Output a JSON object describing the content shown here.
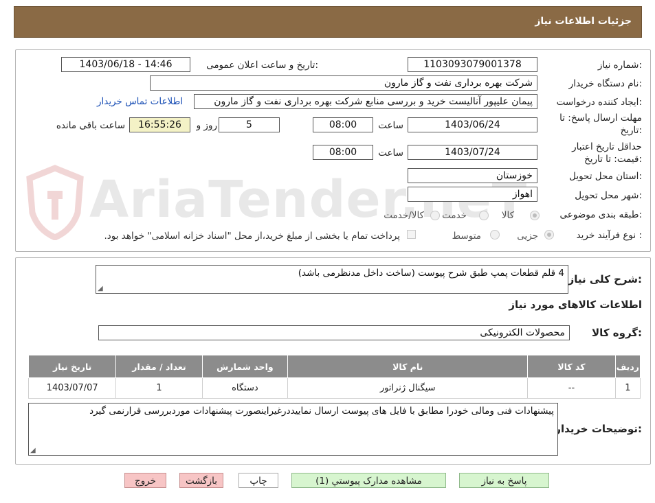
{
  "header": {
    "title": "جزئیات اطلاعات نیاز"
  },
  "form": {
    "need_number_label": "شماره نیاز:",
    "need_number": "1103093079001378",
    "announce_label": "تاریخ و ساعت اعلان عمومی:",
    "announce_value": "1403/06/18 - 14:46",
    "buyer_org_label": "نام دستگاه خریدار:",
    "buyer_org": "شرکت بهره برداری نفت و گاز مارون",
    "creator_label": "ایجاد کننده درخواست:",
    "creator": "پیمان علیپور آنالیست خرید و بررسی منابع شرکت بهره برداری نفت و گاز مارون",
    "contact_link": "اطلاعات تماس خریدار",
    "reply_deadline_label_1": "مهلت ارسال پاسخ: تا",
    "reply_deadline_label_2": "تاریخ:",
    "reply_date": "1403/06/24",
    "time_label": "ساعت",
    "reply_time": "08:00",
    "days_value": "5",
    "days_label": "روز و",
    "remaining_time": "16:55:26",
    "remaining_label": "ساعت باقی مانده",
    "validity_label_1": "حداقل تاریخ اعتبار",
    "validity_label_2": "قیمت: تا تاریخ:",
    "validity_date": "1403/07/24",
    "validity_time": "08:00",
    "province_label": "استان محل تحویل:",
    "province": "خوزستان",
    "city_label": "شهر محل تحویل:",
    "city": "اهواز",
    "category_label": "طبقه بندی موضوعی:",
    "category_options": [
      "کالا",
      "خدمت",
      "کالا/خدمت"
    ],
    "category_selected": "کالا",
    "process_label": "نوع فرآیند خرید :",
    "process_options": [
      "جزیی",
      "متوسط"
    ],
    "process_selected": "جزیی",
    "payment_note": "پرداخت تمام یا بخشی از مبلغ خرید،از محل \"اسناد خزانه اسلامی\" خواهد بود."
  },
  "watermark": {
    "text": "AriaTender.neT"
  },
  "details": {
    "summary_label": "شرح کلی نیاز:",
    "summary": "4 قلم قطعات پمپ طبق شرح پیوست (ساخت داخل مدنظرمی باشد)",
    "goods_info_title": "اطلاعات کالاهای مورد نیاز",
    "goods_group_label": "گروه کالا:",
    "goods_group": "محصولات الکترونیکی",
    "table": {
      "headers": [
        "ردیف",
        "کد کالا",
        "نام کالا",
        "واحد شمارش",
        "تعداد / مقدار",
        "تاریخ نیاز"
      ],
      "rows": [
        [
          "1",
          "--",
          "سیگنال ژنراتور",
          "دستگاه",
          "1",
          "1403/07/07"
        ]
      ]
    },
    "buyer_notes_label": "توضیحات خریدار:",
    "buyer_notes": "پیشنهادات فنی ومالی خودرا  مطابق با فایل های پیوست ارسال نماییددرغیراینصورت پیشنهادات موردبررسی قرارنمی گیرد"
  },
  "buttons": {
    "reply": "پاسخ به نیاز",
    "attachments": "مشاهده مدارک پیوستي (1)",
    "print": "چاپ",
    "back": "بازگشت",
    "exit": "خروج"
  },
  "colors": {
    "header_bg": "#8a6a45",
    "link": "#1a4fb5",
    "table_header": "#8c8c8c",
    "remaining_bg": "#f4f2c6",
    "button_green": "#d7f5cf",
    "button_pink": "#f7c5c5"
  }
}
